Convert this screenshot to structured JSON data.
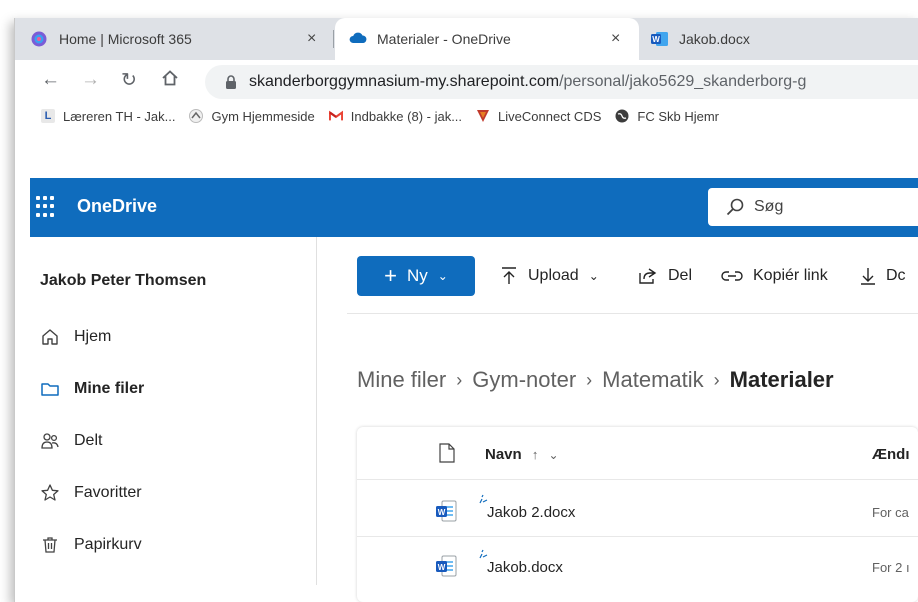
{
  "browser": {
    "tabs": [
      {
        "title": "Home | Microsoft 365",
        "active": false
      },
      {
        "title": "Materialer - OneDrive",
        "active": true
      },
      {
        "title": "Jakob.docx",
        "active": false
      }
    ],
    "close_glyph": "×",
    "url_host": "skanderborggymnasium-my.sharepoint.com",
    "url_path": "/personal/jako5629_skanderborg-g",
    "bookmarks": [
      {
        "label": "Læreren TH - Jak...",
        "icon": "L"
      },
      {
        "label": "Gym Hjemmeside",
        "icon": "gym-logo-icon"
      },
      {
        "label": "Indbakke (8) - jak...",
        "icon": "gmail-icon"
      },
      {
        "label": "LiveConnect CDS",
        "icon": "liveconnect-icon"
      },
      {
        "label": "FC Skb Hjemr",
        "icon": "globe-icon"
      }
    ]
  },
  "app": {
    "name": "OneDrive",
    "search_placeholder": "Søg",
    "brand_color": "#0f6cbd"
  },
  "sidebar": {
    "user": "Jakob Peter Thomsen",
    "items": [
      {
        "label": "Hjem",
        "icon": "home-icon",
        "selected": false
      },
      {
        "label": "Mine filer",
        "icon": "folder-icon",
        "selected": true
      },
      {
        "label": "Delt",
        "icon": "people-icon",
        "selected": false
      },
      {
        "label": "Favoritter",
        "icon": "star-icon",
        "selected": false
      },
      {
        "label": "Papirkurv",
        "icon": "trash-icon",
        "selected": false
      }
    ]
  },
  "toolbar": {
    "new_label": "Ny",
    "upload_label": "Upload",
    "share_label": "Del",
    "copy_link_label": "Kopiér link",
    "download_label": "Dc"
  },
  "breadcrumb": [
    "Mine filer",
    "Gym-noter",
    "Matematik",
    "Materialer"
  ],
  "files": {
    "headers": {
      "name": "Navn",
      "modified": "Ændı"
    },
    "rows": [
      {
        "name": "Jakob 2.docx",
        "modified": "For ca"
      },
      {
        "name": "Jakob.docx",
        "modified": "For 2 ı"
      }
    ]
  }
}
